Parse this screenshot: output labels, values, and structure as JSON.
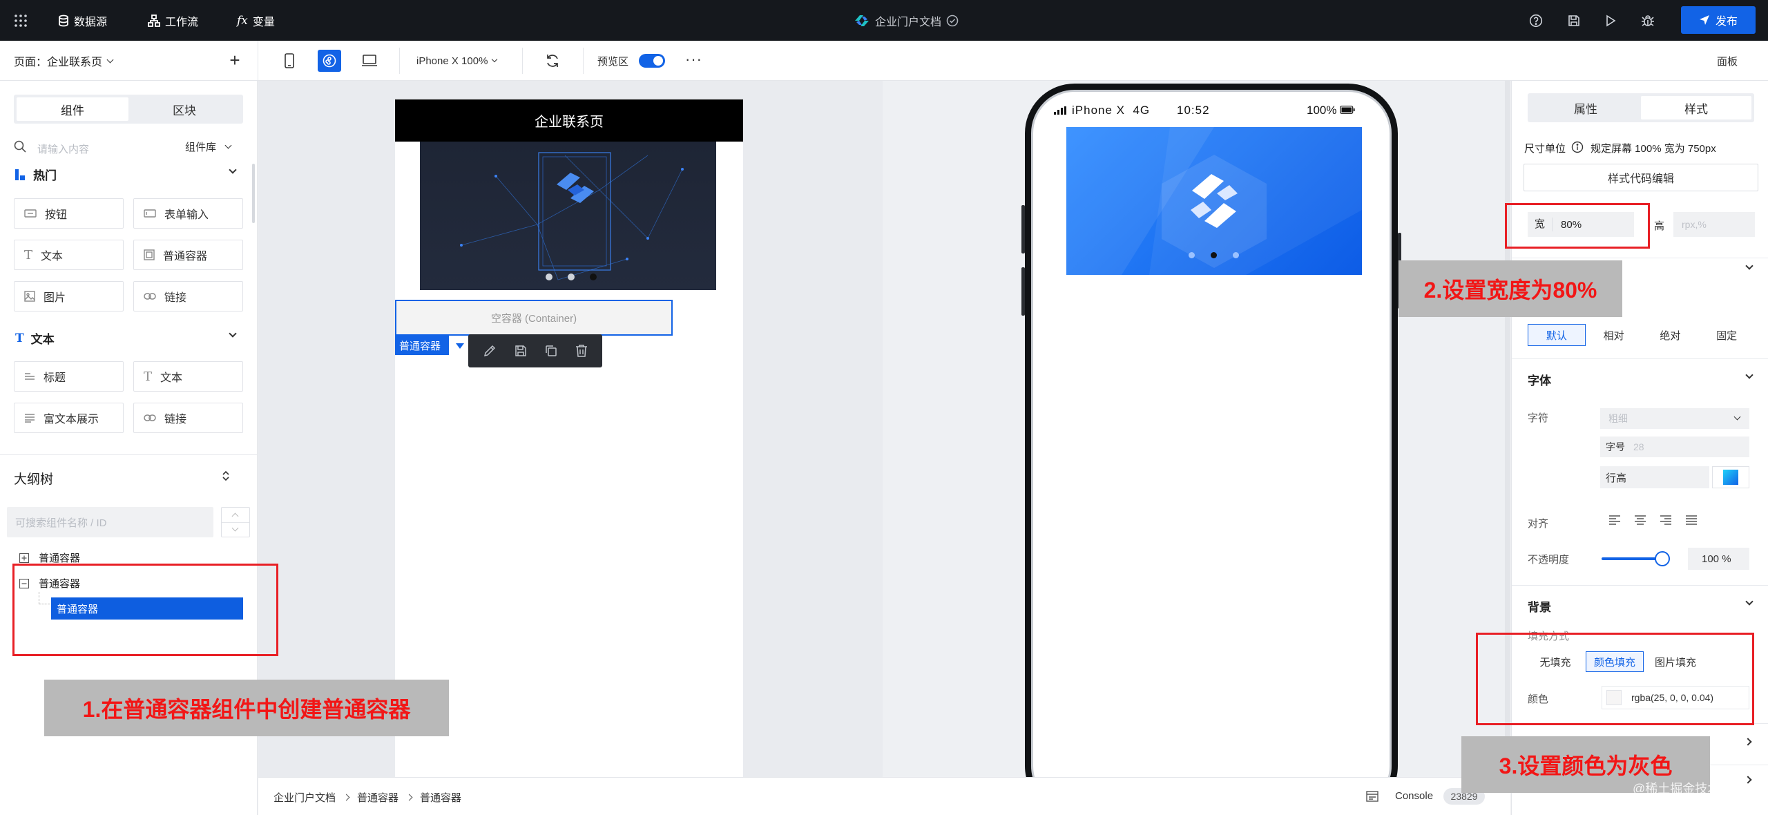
{
  "topbar": {
    "datasource": "数据源",
    "workflow": "工作流",
    "variable": "变量",
    "app_title": "企业门户文档",
    "publish": "发布"
  },
  "toolbar": {
    "page_label": "页面：企业联系页",
    "device": "iPhone X 100%",
    "preview": "预览区",
    "panel": "面板"
  },
  "left": {
    "tabs": [
      "组件",
      "区块"
    ],
    "search_placeholder": "请输入内容",
    "library": "组件库",
    "hot_title": "热门",
    "hot_items": [
      "按钮",
      "表单输入",
      "文本",
      "普通容器",
      "图片",
      "链接"
    ],
    "text_title": "文本",
    "text_items": [
      "标题",
      "文本",
      "富文本展示",
      "链接"
    ],
    "outline_title": "大纲树",
    "outline_search": "可搜索组件名称 / ID",
    "tree": [
      "普通容器",
      "普通容器",
      "普通容器"
    ]
  },
  "canvas": {
    "page_header": "企业联系页",
    "empty_container": "空容器 (Container)",
    "selected_tag": "普通容器",
    "phone_carrier": "iPhone X  4G",
    "phone_time": "10:52",
    "phone_battery": "100%"
  },
  "right": {
    "tabs": [
      "属性",
      "样式"
    ],
    "unit_label": "尺寸单位",
    "unit_value": "规定屏幕 100% 宽为 750px",
    "style_code_btn": "样式代码编辑",
    "width_label": "宽",
    "width_value": "80%",
    "height_label": "高",
    "height_placeholder": "rpx,%",
    "position_opts": [
      "默认",
      "相对",
      "绝对",
      "固定"
    ],
    "font_title": "字体",
    "char_label": "字符",
    "weight_placeholder": "粗细",
    "size_label": "字号",
    "size_placeholder": "28",
    "lineheight_label": "行高",
    "align_label": "对齐",
    "opacity_label": "不透明度",
    "opacity_value": "100 %",
    "opacity_level": 1.0,
    "bg_title": "背景",
    "fill_label": "填充方式",
    "fill_opts": [
      "无填充",
      "颜色填充",
      "图片填充"
    ],
    "color_label": "颜色",
    "color_value": "rgba(25, 0, 0, 0.04)"
  },
  "footer": {
    "crumbs": [
      "企业门户文档",
      "普通容器",
      "普通容器"
    ],
    "console": "Console",
    "count": "23829"
  },
  "annotations": {
    "a1": "1.在普通容器组件中创建普通容器",
    "a2": "2.设置宽度为80%",
    "a3": "3.设置颜色为灰色",
    "watermark": "@稀土掘金技术社区"
  },
  "colors": {
    "accent": "#1263e6",
    "annotation_red": "#e81f25",
    "topbar_bg": "#15181d"
  }
}
